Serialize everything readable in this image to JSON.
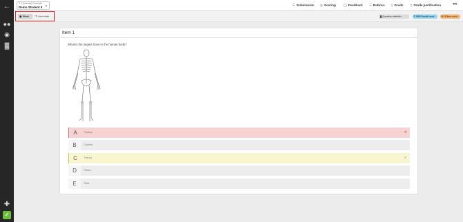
{
  "student": {
    "caption": "T.3 (Manual) Example",
    "name": "Demo Student 5"
  },
  "nav": [
    {
      "label": "Submission",
      "icon": "document-list-icon",
      "glyph": "☰"
    },
    {
      "label": "Scoring",
      "icon": "target-icon",
      "glyph": "◎"
    },
    {
      "label": "Feedback",
      "icon": "speech-bubble-icon",
      "glyph": "◯"
    },
    {
      "label": "Rubrics",
      "icon": "rubric-icon",
      "glyph": "☷"
    },
    {
      "label": "Grade",
      "icon": "clipboard-icon",
      "glyph": "▯"
    },
    {
      "label": "Grade justification",
      "icon": "clipboard-check-icon",
      "glyph": "▯"
    }
  ],
  "toolbar": {
    "view_label": "View",
    "annotate_label": "Annotate",
    "question_stats_label": "Question statistics",
    "overall_score_value": "7 / 20",
    "overall_score_label": "Overall score",
    "item_score_value": "0 / 2",
    "item_score_label": "Item score"
  },
  "item": {
    "title": "Item 1",
    "question": "What is the largest bone in the human body?",
    "options": [
      {
        "letter": "A",
        "text": "Radius",
        "state": "incorrect",
        "mark": "✕"
      },
      {
        "letter": "B",
        "text": "Clavicle",
        "state": "none",
        "mark": ""
      },
      {
        "letter": "C",
        "text": "Femur",
        "state": "correct",
        "mark": "✓"
      },
      {
        "letter": "D",
        "text": "Fibula",
        "state": "none",
        "mark": ""
      },
      {
        "letter": "E",
        "text": "Tibia",
        "state": "none",
        "mark": ""
      }
    ]
  },
  "colors": {
    "rail": "#262626",
    "selection_outline": "#e02020",
    "incorrect_bg": "#f6d2d2",
    "correct_bg": "#f8f6cf",
    "overall_chip": "#8fd3ec",
    "item_chip": "#f2b06a",
    "brand": "#6bbf3f"
  }
}
